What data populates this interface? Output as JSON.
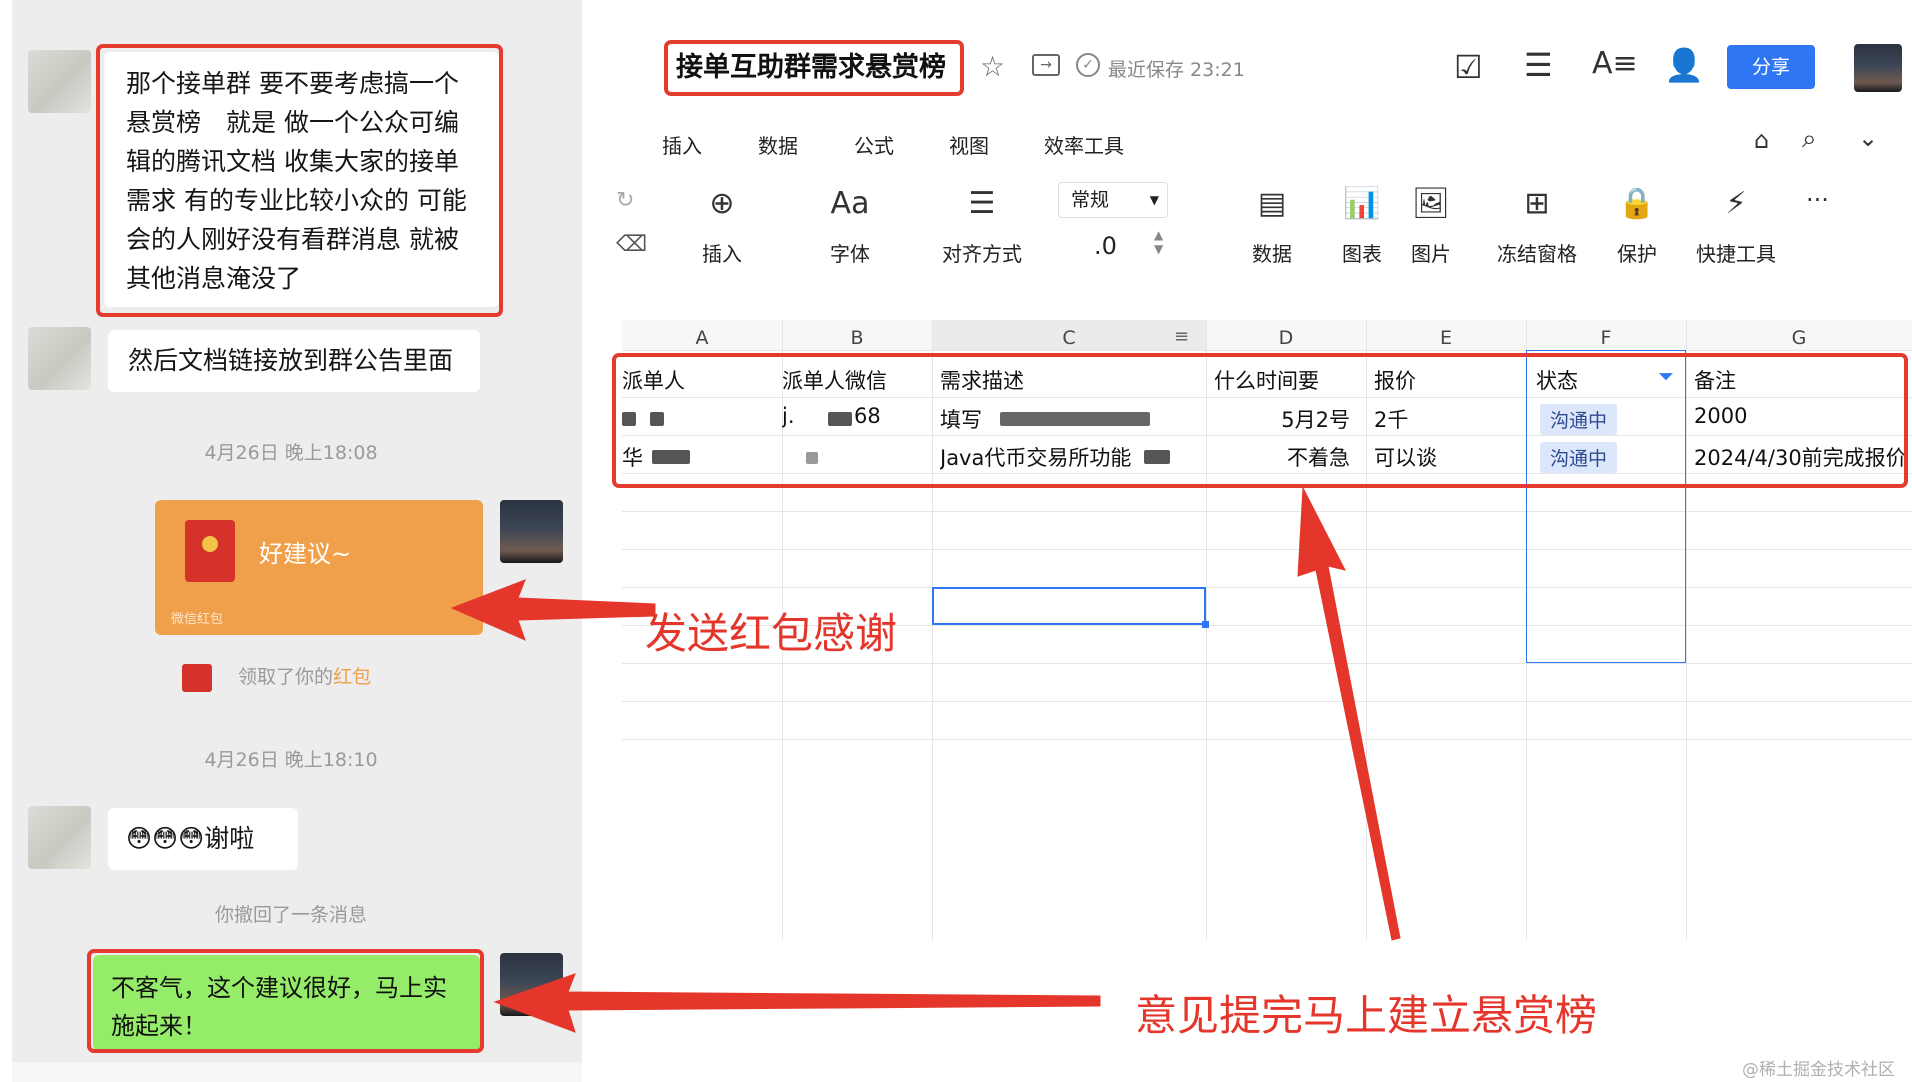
{
  "chat": {
    "messages": [
      {
        "text": "那个接单群 要不要考虑搞一个悬赏榜　就是 做一个公众可编辑的腾讯文档 收集大家的接单需求 有的专业比较小众的 可能会的人刚好没有看群消息 就被其他消息淹没了"
      },
      {
        "text": "然后文档链接放到群公告里面"
      }
    ],
    "time_1": "4月26日 晚上18:08",
    "red_packet": {
      "label": "好建议~",
      "footer": "微信红包"
    },
    "red_packet_notice": {
      "prefix": "领取了你的",
      "highlight": "红包"
    },
    "time_2": "4月26日 晚上18:10",
    "thanks": {
      "emojis": "😳😳😳",
      "text": "谢啦"
    },
    "recall_notice": "你撤回了一条消息",
    "reply": "不客气，这个建议很好，马上实施起来！"
  },
  "doc": {
    "title": "接单互助群需求悬赏榜",
    "save_status": "最近保存 23:21",
    "share_label": "分享",
    "menu": [
      "插入",
      "数据",
      "公式",
      "视图",
      "效率工具"
    ],
    "toolbar": [
      {
        "icon": "⊕",
        "label": "插入"
      },
      {
        "icon": "Aa",
        "label": "字体"
      },
      {
        "icon": "☰",
        "label": "对齐方式"
      },
      {
        "icon": "▤",
        "label": "数据"
      },
      {
        "icon": "📊",
        "label": "图表"
      },
      {
        "icon": "🖼",
        "label": "图片"
      },
      {
        "icon": "⊞",
        "label": "冻结窗格"
      },
      {
        "icon": "🔒",
        "label": "保护"
      },
      {
        "icon": "⚡",
        "label": "快捷工具"
      }
    ],
    "number_format": "常规",
    "decimal": ".0",
    "more": "···"
  },
  "sheet": {
    "columns": [
      "A",
      "B",
      "C",
      "D",
      "E",
      "F",
      "G"
    ],
    "headers": [
      "派单人",
      "派单人微信",
      "需求描述",
      "什么时间要",
      "报价",
      "状态",
      "备注"
    ],
    "rows": [
      [
        "",
        "j.",
        "填写",
        "5月2号",
        "2千",
        "沟通中",
        "2000"
      ],
      [
        "华",
        "",
        "Java代币交易所功能",
        "不着急",
        "可以谈",
        "沟通中",
        "2024/4/30前完成报价"
      ]
    ],
    "row2_b_tail": "68"
  },
  "annotations": {
    "red_packet": "发送红包感谢",
    "board": "意见提完马上建立悬赏榜"
  },
  "watermark": "@稀土掘金技术社区"
}
